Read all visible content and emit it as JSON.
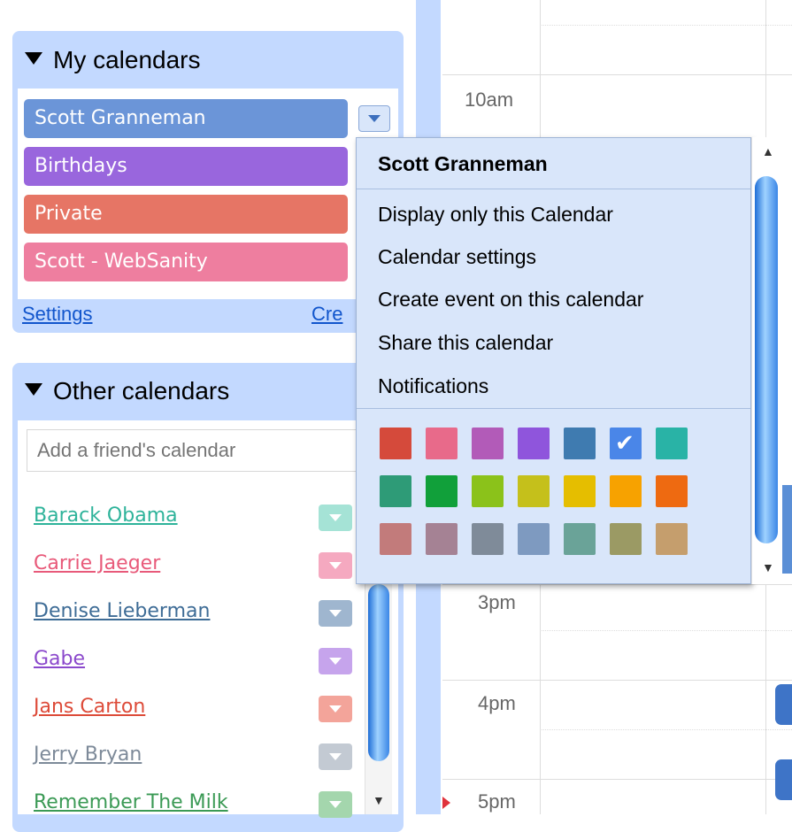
{
  "my_calendars": {
    "title": "My calendars",
    "items": [
      {
        "label": "Scott Granneman",
        "color": "#6b95d8"
      },
      {
        "label": "Birthdays",
        "color": "#9966dd"
      },
      {
        "label": "Private",
        "color": "#e67565"
      },
      {
        "label": "Scott - WebSanity",
        "color": "#ee7e9f"
      }
    ],
    "settings_link": "Settings",
    "create_link": "Cre"
  },
  "other_calendars": {
    "title": "Other calendars",
    "search_placeholder": "Add a friend's calendar",
    "items": [
      {
        "label": "Barack Obama",
        "color": "#2eb39a"
      },
      {
        "label": "Carrie Jaeger",
        "color": "#e85a7a"
      },
      {
        "label": "Denise Lieberman",
        "color": "#3e6c96"
      },
      {
        "label": "Gabe",
        "color": "#8b49cc"
      },
      {
        "label": "Jans Carton",
        "color": "#dd4b39"
      },
      {
        "label": "Jerry Bryan",
        "color": "#7d8a99"
      },
      {
        "label": "Remember The Milk",
        "color": "#3b9a55"
      }
    ]
  },
  "timeline": {
    "times": [
      "10am",
      "3pm",
      "4pm",
      "5pm"
    ]
  },
  "menu": {
    "title": "Scott Granneman",
    "items": [
      "Display only this Calendar",
      "Calendar settings",
      "Create event on this calendar",
      "Share this calendar",
      "Notifications"
    ],
    "selected_color": "#4a86e8",
    "colors": [
      [
        "#d54a3b",
        "#e86a8a",
        "#b25bb8",
        "#8f55dc",
        "#3f7bb0",
        "#4a86e8",
        "#29b3a6"
      ],
      [
        "#2e9b77",
        "#11a03a",
        "#8bc21a",
        "#c5c01b",
        "#e5be00",
        "#f7a200",
        "#ee6a11"
      ],
      [
        "#c27b7b",
        "#a58294",
        "#7f8b99",
        "#7e9ac0",
        "#6aa398",
        "#9b9a64",
        "#c59e6d"
      ]
    ]
  }
}
